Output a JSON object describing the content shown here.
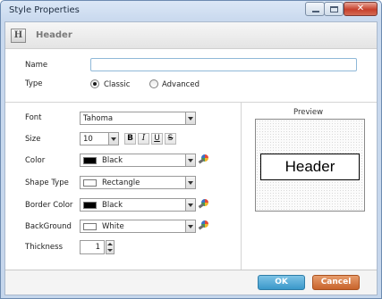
{
  "window": {
    "title": "Style Properties"
  },
  "header": {
    "icon_glyph": "H",
    "title": "Header"
  },
  "form": {
    "name_label": "Name",
    "name_value": "",
    "type_label": "Type",
    "type_options": [
      {
        "label": "Classic",
        "selected": true
      },
      {
        "label": "Advanced",
        "selected": false
      }
    ],
    "font_label": "Font",
    "font_value": "Tahoma",
    "size_label": "Size",
    "size_value": "10",
    "format_buttons": {
      "bold": "B",
      "italic": "I",
      "underline": "U",
      "strike": "S"
    },
    "color_label": "Color",
    "color_value": "Black",
    "shape_type_label": "Shape Type",
    "shape_type_value": "Rectangle",
    "border_color_label": "Border Color",
    "border_color_value": "Black",
    "background_label": "BackGround",
    "background_value": "White",
    "thickness_label": "Thickness",
    "thickness_value": "1"
  },
  "preview": {
    "label": "Preview",
    "text": "Header"
  },
  "buttons": {
    "ok": "OK",
    "cancel": "Cancel"
  },
  "colors": {
    "ok_button": "#3a98c9",
    "cancel_button": "#c8632b",
    "swatch_black": "#000000",
    "swatch_white": "#ffffff",
    "input_border": "#8fb8d8"
  },
  "icons": {
    "header": "h-icon",
    "color_picker": "palette-picker-icon",
    "combo_arrow": "chevron-down-icon"
  }
}
